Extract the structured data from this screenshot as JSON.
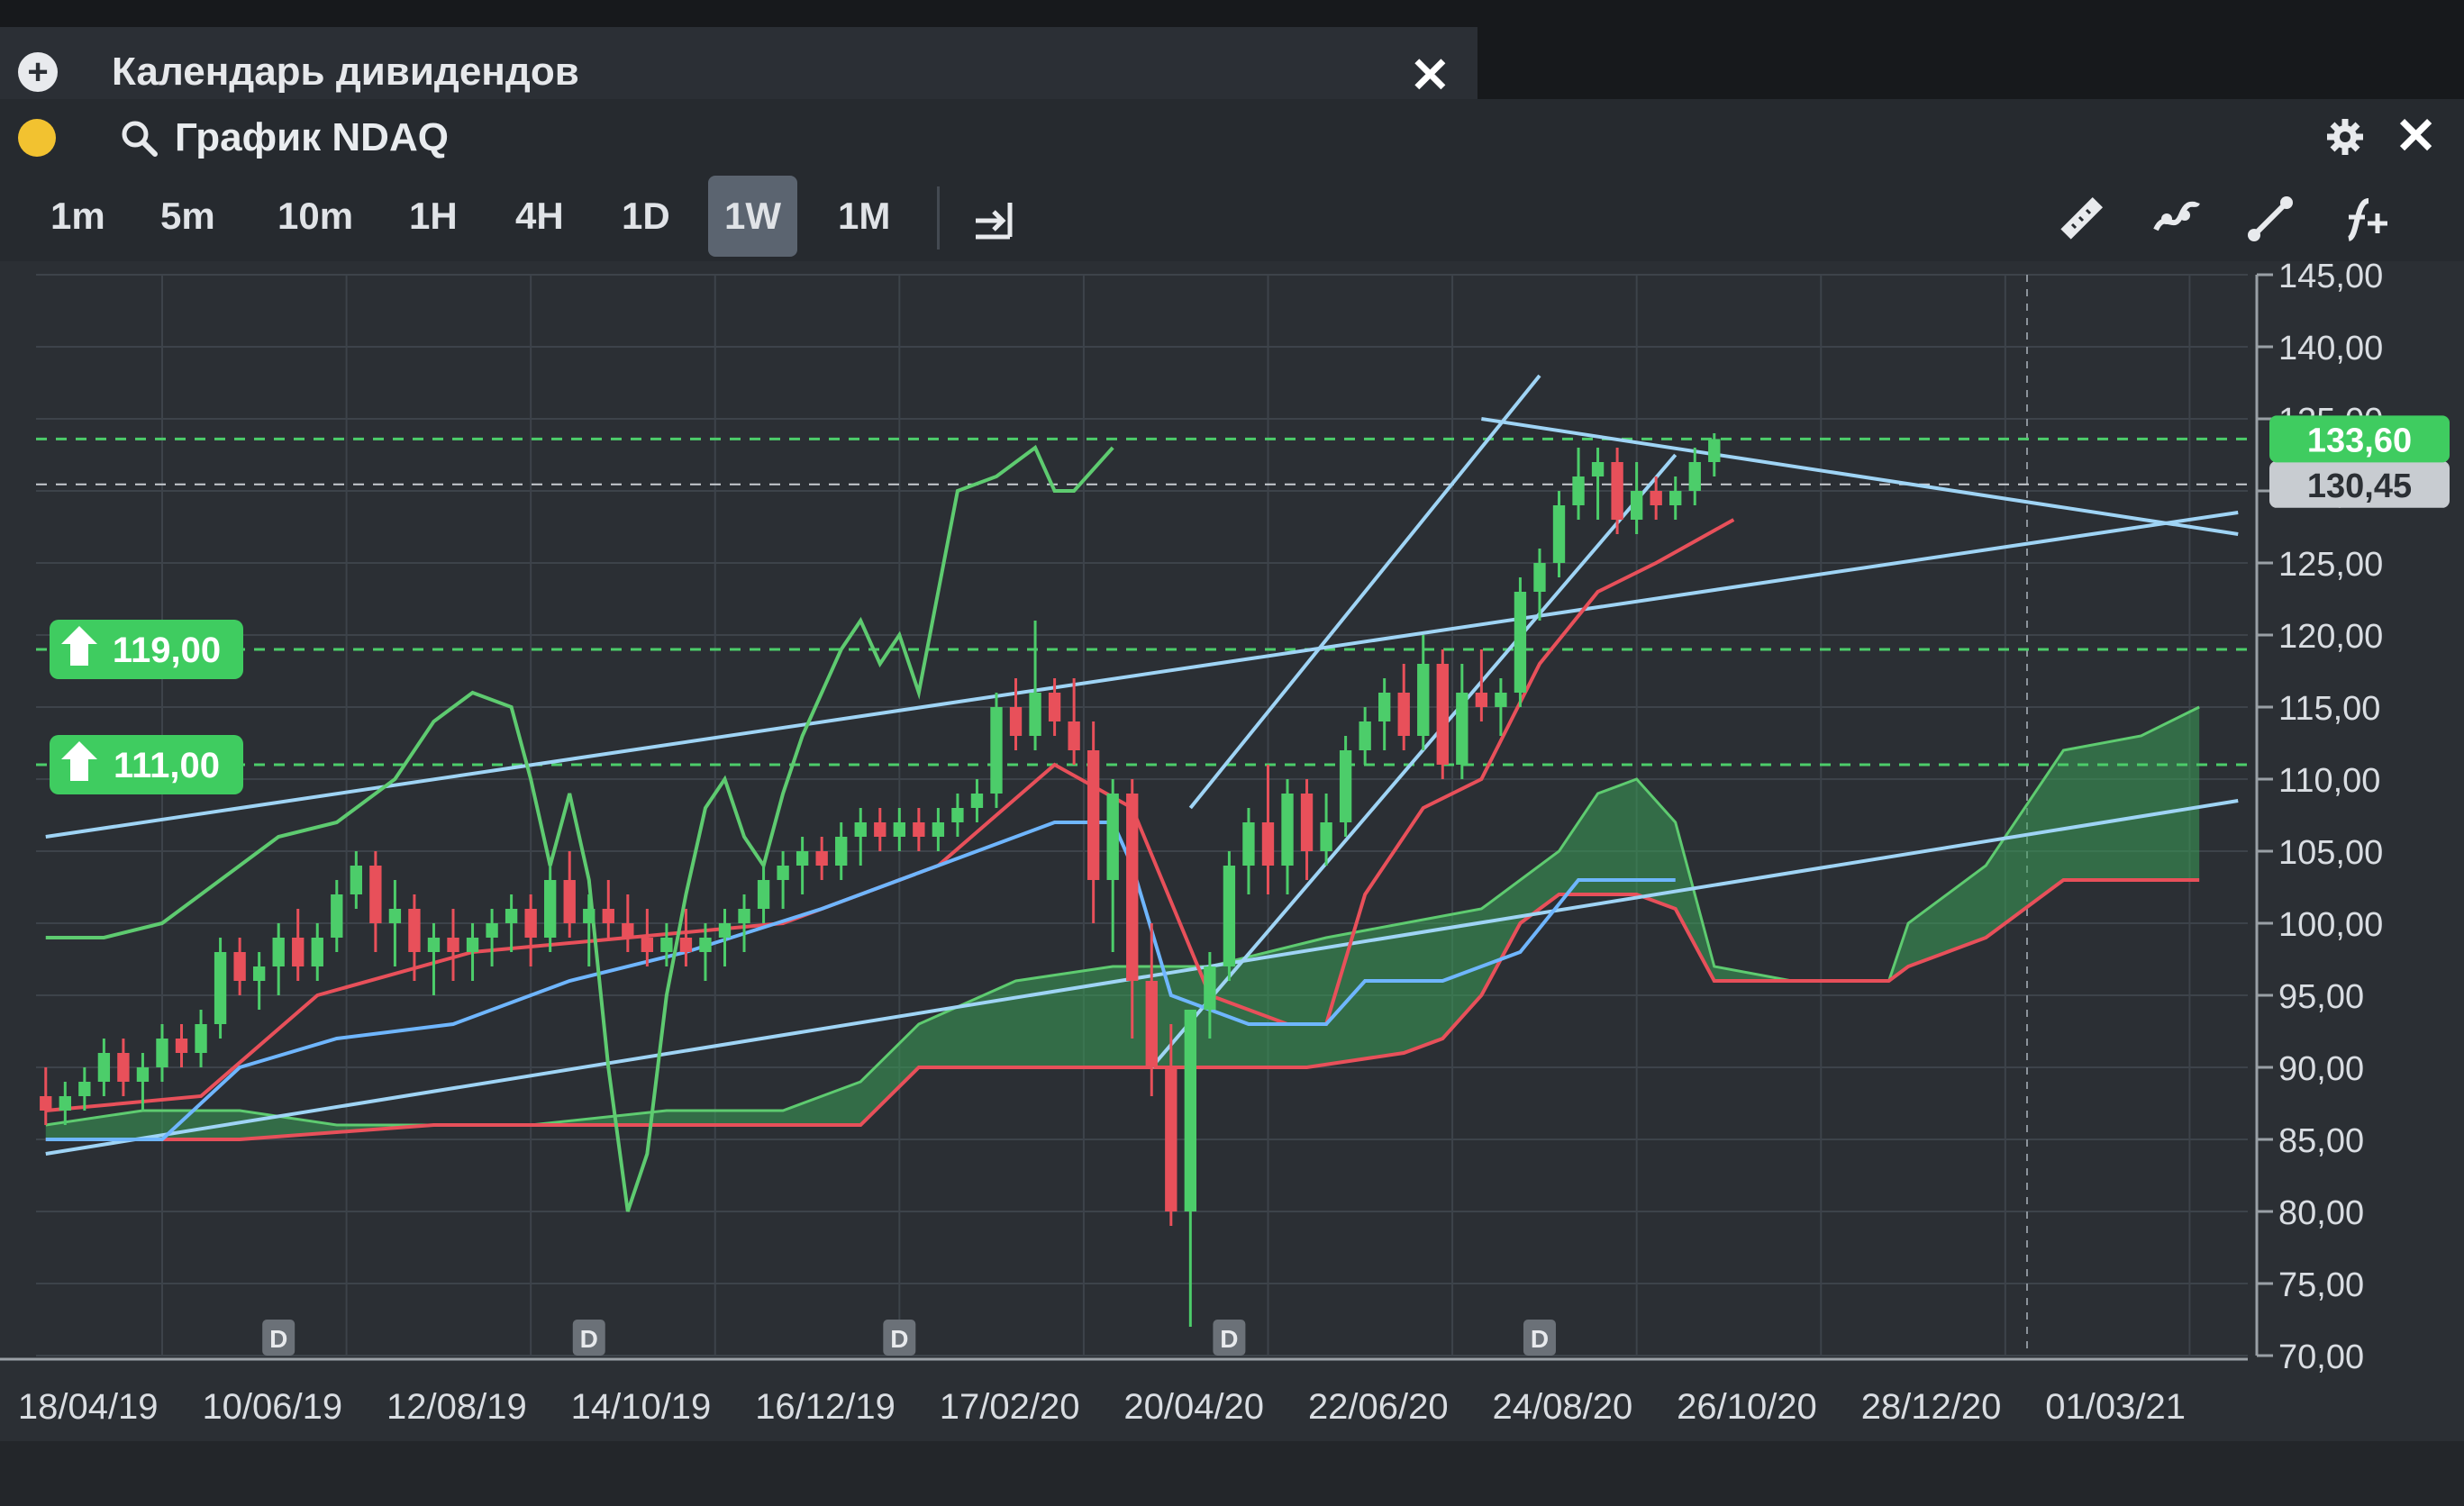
{
  "tab": {
    "label": "Календарь дивидендов"
  },
  "widget": {
    "title": "График NDAQ"
  },
  "timeframes": [
    {
      "label": "1m",
      "active": false
    },
    {
      "label": "5m",
      "active": false
    },
    {
      "label": "10m",
      "active": false
    },
    {
      "label": "1H",
      "active": false
    },
    {
      "label": "4H",
      "active": false
    },
    {
      "label": "1D",
      "active": false
    },
    {
      "label": "1W",
      "active": true
    },
    {
      "label": "1M",
      "active": false
    }
  ],
  "icons": {
    "tab_add": "plus-circle-icon",
    "tab_close": "close-icon",
    "search": "search-icon",
    "settings": "gear-icon",
    "widget_close": "close-icon",
    "jump_to_latest": "arrow-to-end-icon",
    "ruler": "ruler-icon",
    "indicators": "indicators-icon",
    "trendline": "trendline-icon",
    "add_function": "function-add-icon"
  },
  "colors": {
    "up": "#4ccd6a",
    "down": "#e8505a",
    "price_tag": "#3fcc60",
    "trendline": "#9fd4f5",
    "cloud": "#3b9e57"
  },
  "chart_data": {
    "type": "candlestick",
    "symbol": "NDAQ",
    "timeframe": "1W",
    "ylim": [
      70,
      145
    ],
    "y_ticks": [
      "145,00",
      "140,00",
      "135,00",
      "130,00",
      "125,00",
      "120,00",
      "115,00",
      "110,00",
      "105,00",
      "100,00",
      "95,00",
      "90,00",
      "85,00",
      "80,00",
      "75,00",
      "70,00"
    ],
    "x_ticks": [
      "18/04/19",
      "10/06/19",
      "12/08/19",
      "14/10/19",
      "16/12/19",
      "17/02/20",
      "20/04/20",
      "22/06/20",
      "24/08/20",
      "26/10/20",
      "28/12/20",
      "01/03/21"
    ],
    "current_price_label": "133,60",
    "current_price": 133.6,
    "level_label": "130,45",
    "level": 130.45,
    "alerts": [
      {
        "label": "119,00",
        "price": 119.0
      },
      {
        "label": "111,00",
        "price": 111.0
      }
    ],
    "dividend_marker": "D",
    "dividend_markers_at_week": [
      12,
      28,
      44,
      61,
      77
    ],
    "candles": [
      {
        "o": 88,
        "h": 90,
        "l": 86,
        "c": 87
      },
      {
        "o": 87,
        "h": 89,
        "l": 86,
        "c": 88
      },
      {
        "o": 88,
        "h": 90,
        "l": 87,
        "c": 89
      },
      {
        "o": 89,
        "h": 92,
        "l": 88,
        "c": 91
      },
      {
        "o": 91,
        "h": 92,
        "l": 88,
        "c": 89
      },
      {
        "o": 89,
        "h": 91,
        "l": 87,
        "c": 90
      },
      {
        "o": 90,
        "h": 93,
        "l": 89,
        "c": 92
      },
      {
        "o": 92,
        "h": 93,
        "l": 90,
        "c": 91
      },
      {
        "o": 91,
        "h": 94,
        "l": 90,
        "c": 93
      },
      {
        "o": 93,
        "h": 99,
        "l": 92,
        "c": 98
      },
      {
        "o": 98,
        "h": 99,
        "l": 95,
        "c": 96
      },
      {
        "o": 96,
        "h": 98,
        "l": 94,
        "c": 97
      },
      {
        "o": 97,
        "h": 100,
        "l": 95,
        "c": 99
      },
      {
        "o": 99,
        "h": 101,
        "l": 96,
        "c": 97
      },
      {
        "o": 97,
        "h": 100,
        "l": 96,
        "c": 99
      },
      {
        "o": 99,
        "h": 103,
        "l": 98,
        "c": 102
      },
      {
        "o": 102,
        "h": 105,
        "l": 101,
        "c": 104
      },
      {
        "o": 104,
        "h": 105,
        "l": 98,
        "c": 100
      },
      {
        "o": 100,
        "h": 103,
        "l": 97,
        "c": 101
      },
      {
        "o": 101,
        "h": 102,
        "l": 96,
        "c": 98
      },
      {
        "o": 98,
        "h": 100,
        "l": 95,
        "c": 99
      },
      {
        "o": 99,
        "h": 101,
        "l": 96,
        "c": 98
      },
      {
        "o": 98,
        "h": 100,
        "l": 96,
        "c": 99
      },
      {
        "o": 99,
        "h": 101,
        "l": 97,
        "c": 100
      },
      {
        "o": 100,
        "h": 102,
        "l": 98,
        "c": 101
      },
      {
        "o": 101,
        "h": 102,
        "l": 97,
        "c": 99
      },
      {
        "o": 99,
        "h": 104,
        "l": 98,
        "c": 103
      },
      {
        "o": 103,
        "h": 105,
        "l": 99,
        "c": 100
      },
      {
        "o": 100,
        "h": 102,
        "l": 97,
        "c": 101
      },
      {
        "o": 101,
        "h": 103,
        "l": 99,
        "c": 100
      },
      {
        "o": 100,
        "h": 102,
        "l": 98,
        "c": 99
      },
      {
        "o": 99,
        "h": 101,
        "l": 97,
        "c": 98
      },
      {
        "o": 98,
        "h": 100,
        "l": 97,
        "c": 99
      },
      {
        "o": 99,
        "h": 101,
        "l": 97,
        "c": 98
      },
      {
        "o": 98,
        "h": 100,
        "l": 96,
        "c": 99
      },
      {
        "o": 99,
        "h": 101,
        "l": 97,
        "c": 100
      },
      {
        "o": 100,
        "h": 102,
        "l": 98,
        "c": 101
      },
      {
        "o": 101,
        "h": 104,
        "l": 100,
        "c": 103
      },
      {
        "o": 103,
        "h": 105,
        "l": 101,
        "c": 104
      },
      {
        "o": 104,
        "h": 106,
        "l": 102,
        "c": 105
      },
      {
        "o": 105,
        "h": 106,
        "l": 103,
        "c": 104
      },
      {
        "o": 104,
        "h": 107,
        "l": 103,
        "c": 106
      },
      {
        "o": 106,
        "h": 108,
        "l": 104,
        "c": 107
      },
      {
        "o": 107,
        "h": 108,
        "l": 105,
        "c": 106
      },
      {
        "o": 106,
        "h": 108,
        "l": 105,
        "c": 107
      },
      {
        "o": 107,
        "h": 108,
        "l": 105,
        "c": 106
      },
      {
        "o": 106,
        "h": 108,
        "l": 105,
        "c": 107
      },
      {
        "o": 107,
        "h": 109,
        "l": 106,
        "c": 108
      },
      {
        "o": 108,
        "h": 110,
        "l": 107,
        "c": 109
      },
      {
        "o": 109,
        "h": 116,
        "l": 108,
        "c": 115
      },
      {
        "o": 115,
        "h": 117,
        "l": 112,
        "c": 113
      },
      {
        "o": 113,
        "h": 121,
        "l": 112,
        "c": 116
      },
      {
        "o": 116,
        "h": 117,
        "l": 113,
        "c": 114
      },
      {
        "o": 114,
        "h": 117,
        "l": 111,
        "c": 112
      },
      {
        "o": 112,
        "h": 114,
        "l": 100,
        "c": 103
      },
      {
        "o": 103,
        "h": 110,
        "l": 98,
        "c": 109
      },
      {
        "o": 109,
        "h": 110,
        "l": 92,
        "c": 96
      },
      {
        "o": 96,
        "h": 100,
        "l": 88,
        "c": 90
      },
      {
        "o": 90,
        "h": 93,
        "l": 79,
        "c": 80
      },
      {
        "o": 80,
        "h": 93,
        "l": 72,
        "c": 94
      },
      {
        "o": 94,
        "h": 98,
        "l": 92,
        "c": 97
      },
      {
        "o": 97,
        "h": 105,
        "l": 96,
        "c": 104
      },
      {
        "o": 104,
        "h": 108,
        "l": 102,
        "c": 107
      },
      {
        "o": 107,
        "h": 111,
        "l": 102,
        "c": 104
      },
      {
        "o": 104,
        "h": 110,
        "l": 102,
        "c": 109
      },
      {
        "o": 109,
        "h": 110,
        "l": 103,
        "c": 105
      },
      {
        "o": 105,
        "h": 109,
        "l": 104,
        "c": 107
      },
      {
        "o": 107,
        "h": 113,
        "l": 106,
        "c": 112
      },
      {
        "o": 112,
        "h": 115,
        "l": 111,
        "c": 114
      },
      {
        "o": 114,
        "h": 117,
        "l": 112,
        "c": 116
      },
      {
        "o": 116,
        "h": 118,
        "l": 112,
        "c": 113
      },
      {
        "o": 113,
        "h": 120,
        "l": 112,
        "c": 118
      },
      {
        "o": 118,
        "h": 119,
        "l": 110,
        "c": 111
      },
      {
        "o": 111,
        "h": 118,
        "l": 110,
        "c": 116
      },
      {
        "o": 116,
        "h": 119,
        "l": 114,
        "c": 115
      },
      {
        "o": 115,
        "h": 117,
        "l": 113,
        "c": 116
      },
      {
        "o": 116,
        "h": 124,
        "l": 115,
        "c": 123
      },
      {
        "o": 123,
        "h": 126,
        "l": 121,
        "c": 125
      },
      {
        "o": 125,
        "h": 130,
        "l": 124,
        "c": 129
      },
      {
        "o": 129,
        "h": 133,
        "l": 128,
        "c": 131
      },
      {
        "o": 131,
        "h": 133,
        "l": 128,
        "c": 132
      },
      {
        "o": 132,
        "h": 133,
        "l": 127,
        "c": 128
      },
      {
        "o": 128,
        "h": 132,
        "l": 127,
        "c": 130
      },
      {
        "o": 130,
        "h": 131,
        "l": 128,
        "c": 129
      },
      {
        "o": 129,
        "h": 131,
        "l": 128,
        "c": 130
      },
      {
        "o": 130,
        "h": 133,
        "l": 129,
        "c": 132
      },
      {
        "o": 132,
        "h": 134,
        "l": 131,
        "c": 133.6
      }
    ],
    "indicator_lines": [
      {
        "color": "#e8505a",
        "points": [
          [
            0,
            87
          ],
          [
            8,
            88
          ],
          [
            14,
            95
          ],
          [
            22,
            98
          ],
          [
            30,
            99
          ],
          [
            38,
            100
          ],
          [
            46,
            104
          ],
          [
            52,
            111
          ],
          [
            56,
            108
          ],
          [
            60,
            95
          ],
          [
            64,
            93
          ],
          [
            66,
            93
          ],
          [
            68,
            102
          ],
          [
            71,
            108
          ],
          [
            74,
            110
          ],
          [
            77,
            118
          ],
          [
            80,
            123
          ],
          [
            83,
            125
          ],
          [
            87,
            128
          ]
        ]
      },
      {
        "color": "#6fb6ff",
        "points": [
          [
            0,
            85
          ],
          [
            6,
            85
          ],
          [
            10,
            90
          ],
          [
            15,
            92
          ],
          [
            21,
            93
          ],
          [
            27,
            96
          ],
          [
            33,
            98
          ],
          [
            40,
            101
          ],
          [
            46,
            104
          ],
          [
            52,
            107
          ],
          [
            55,
            107
          ],
          [
            56,
            104
          ],
          [
            58,
            95
          ],
          [
            62,
            93
          ],
          [
            66,
            93
          ],
          [
            68,
            96
          ],
          [
            72,
            96
          ],
          [
            76,
            98
          ],
          [
            79,
            103
          ],
          [
            84,
            103
          ]
        ]
      },
      {
        "color": "#5ecb70",
        "points": [
          [
            0,
            99
          ],
          [
            3,
            99
          ],
          [
            6,
            100
          ],
          [
            9,
            103
          ],
          [
            12,
            106
          ],
          [
            15,
            107
          ],
          [
            18,
            110
          ],
          [
            20,
            114
          ],
          [
            22,
            116
          ],
          [
            24,
            115
          ],
          [
            25,
            110
          ],
          [
            26,
            104
          ],
          [
            27,
            109
          ],
          [
            28,
            103
          ],
          [
            29,
            90
          ],
          [
            30,
            80
          ],
          [
            31,
            84
          ],
          [
            32,
            95
          ],
          [
            33,
            102
          ],
          [
            34,
            108
          ],
          [
            35,
            110
          ],
          [
            36,
            106
          ],
          [
            37,
            104
          ],
          [
            38,
            109
          ],
          [
            39,
            113
          ],
          [
            40,
            116
          ],
          [
            41,
            119
          ],
          [
            42,
            121
          ],
          [
            43,
            118
          ],
          [
            44,
            120
          ],
          [
            45,
            116
          ],
          [
            47,
            130
          ],
          [
            49,
            131
          ],
          [
            51,
            133
          ],
          [
            52,
            130
          ],
          [
            53,
            130
          ],
          [
            55,
            133
          ]
        ]
      }
    ],
    "cloud": {
      "top": [
        [
          0,
          86
        ],
        [
          5,
          87
        ],
        [
          10,
          87
        ],
        [
          15,
          86
        ],
        [
          20,
          86
        ],
        [
          25,
          86
        ],
        [
          32,
          87
        ],
        [
          38,
          87
        ],
        [
          42,
          89
        ],
        [
          45,
          93
        ],
        [
          50,
          96
        ],
        [
          55,
          97
        ],
        [
          60,
          97
        ],
        [
          63,
          98
        ],
        [
          66,
          99
        ],
        [
          70,
          100
        ],
        [
          74,
          101
        ],
        [
          76,
          103
        ],
        [
          78,
          105
        ],
        [
          80,
          109
        ],
        [
          82,
          110
        ],
        [
          84,
          107
        ],
        [
          86,
          97
        ],
        [
          90,
          96
        ],
        [
          95,
          96
        ],
        [
          96,
          100
        ],
        [
          100,
          104
        ],
        [
          104,
          112
        ],
        [
          108,
          113
        ],
        [
          111,
          115
        ]
      ],
      "bottom": [
        [
          0,
          85
        ],
        [
          10,
          85
        ],
        [
          20,
          86
        ],
        [
          30,
          86
        ],
        [
          38,
          86
        ],
        [
          42,
          86
        ],
        [
          45,
          90
        ],
        [
          55,
          90
        ],
        [
          65,
          90
        ],
        [
          70,
          91
        ],
        [
          72,
          92
        ],
        [
          74,
          95
        ],
        [
          76,
          100
        ],
        [
          78,
          102
        ],
        [
          82,
          102
        ],
        [
          84,
          101
        ],
        [
          86,
          96
        ],
        [
          90,
          96
        ],
        [
          95,
          96
        ],
        [
          96,
          97
        ],
        [
          100,
          99
        ],
        [
          104,
          103
        ],
        [
          108,
          103
        ],
        [
          111,
          103
        ]
      ]
    },
    "trendlines": [
      {
        "from": [
          0,
          106
        ],
        "to": [
          113,
          128.5
        ]
      },
      {
        "from": [
          0,
          84
        ],
        "to": [
          113,
          108.5
        ]
      },
      {
        "from": [
          57,
          90
        ],
        "to": [
          84,
          132.5
        ]
      },
      {
        "from": [
          59,
          108
        ],
        "to": [
          77,
          138
        ]
      },
      {
        "from": [
          74,
          135
        ],
        "to": [
          113,
          127
        ]
      }
    ]
  }
}
